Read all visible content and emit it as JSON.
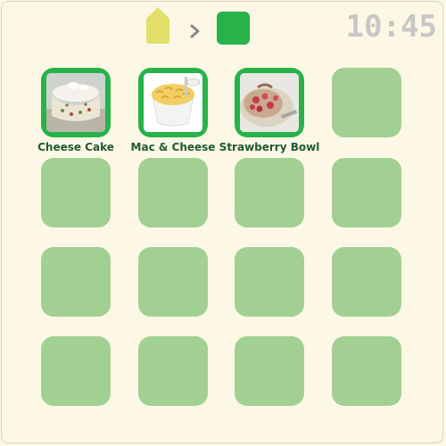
{
  "header": {
    "home_icon": "home-icon",
    "separator_icon": "chevron-right-icon",
    "folder_icon": "folder-icon",
    "clock": "10:45",
    "colors": {
      "home": "#e2e06a",
      "folder": "#27b24a",
      "clock": "#c7c7c7"
    }
  },
  "grid": {
    "apps": [
      {
        "label": "Cheese Cake"
      },
      {
        "label": "Mac & Cheese"
      },
      {
        "label": "Strawberry Bowl"
      }
    ],
    "colors": {
      "empty_tile": "#a2cf92",
      "app_tile": "#27b24a",
      "label": "#1f5a2d"
    }
  }
}
